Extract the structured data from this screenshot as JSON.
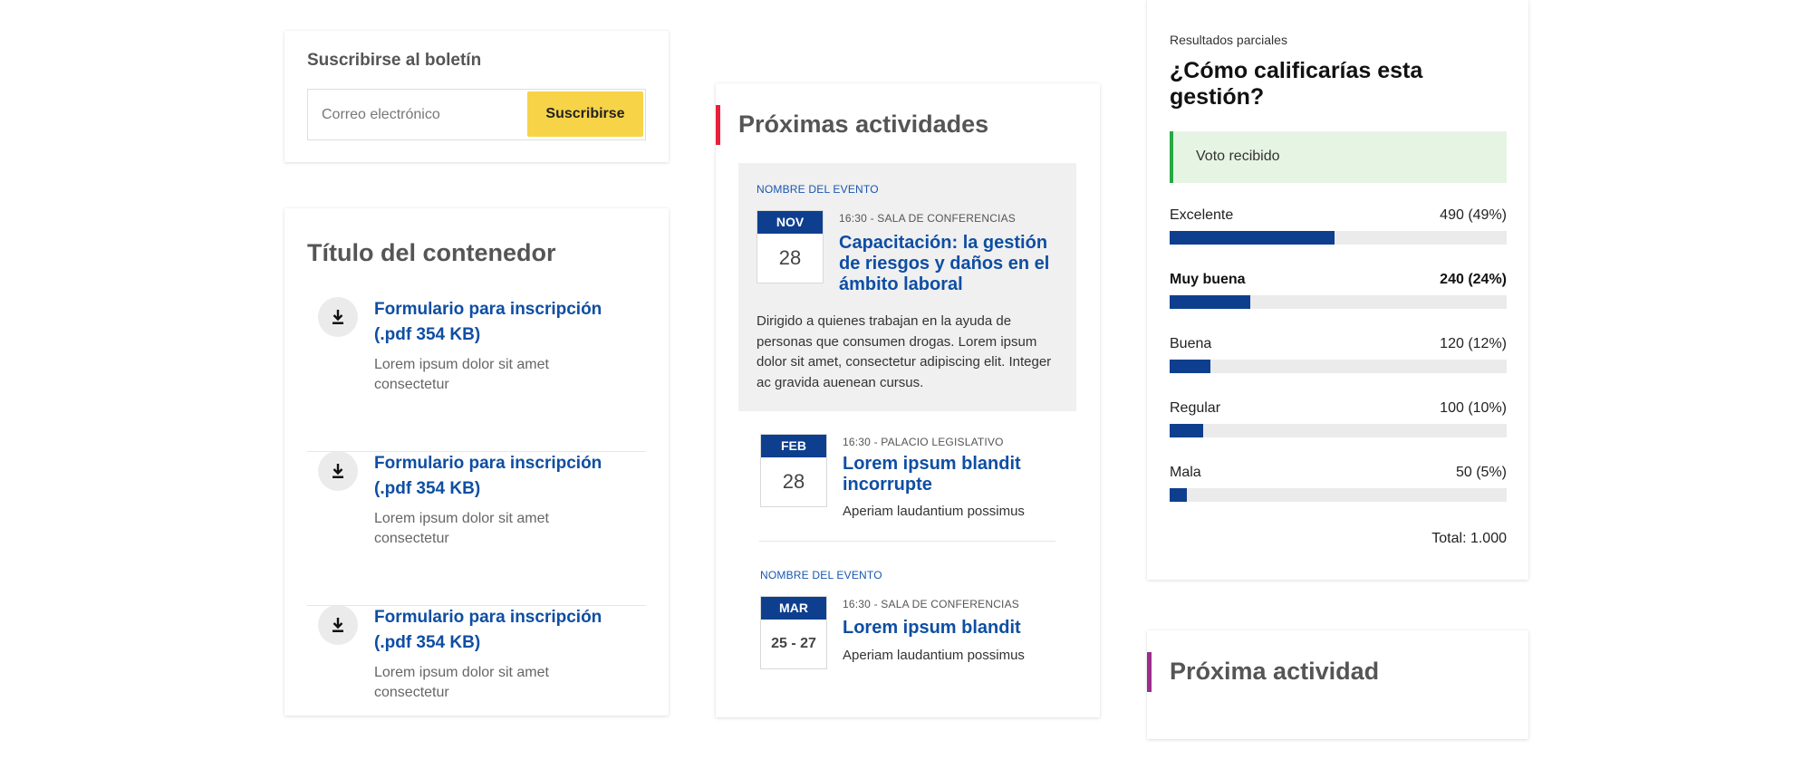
{
  "newsletter": {
    "title": "Suscribirse al boletín",
    "email_placeholder": "Correo electrónico",
    "submit_label": "Suscribirse"
  },
  "downloads": {
    "title": "Título del contenedor",
    "items": [
      {
        "link": "Formulario para inscripción (.pdf 354 KB)",
        "desc": "Lorem ipsum dolor sit amet consectetur",
        "icon": "download-icon"
      },
      {
        "link": "Formulario para inscripción (.pdf 354 KB)",
        "desc": "Lorem ipsum dolor sit amet consectetur",
        "icon": "download-icon"
      },
      {
        "link": "Formulario para inscripción (.pdf 354 KB)",
        "desc": "Lorem ipsum dolor sit amet consectetur",
        "icon": "download-icon"
      }
    ]
  },
  "activities": {
    "title": "Próximas actividades",
    "accent": "#e8203a",
    "events": [
      {
        "kicker": "NOMBRE DEL EVENTO",
        "month": "NOV",
        "day": "28",
        "meta": "16:30 - SALA DE CONFERENCIAS",
        "title": "Capacitación: la gestión de riesgos y daños en el ámbito laboral",
        "body": "Dirigido a quienes trabajan en la ayuda de personas que consumen drogas. Lorem ipsum dolor sit amet, consectetur adipiscing elit. Integer ac gravida auenean cursus."
      },
      {
        "month": "FEB",
        "day": "28",
        "meta": "16:30 - PALACIO LEGISLATIVO",
        "title": "Lorem ipsum blandit incorrupte",
        "sub": "Aperiam laudantium possimus"
      },
      {
        "kicker": "NOMBRE DEL EVENTO",
        "month": "MAR",
        "day": "25 - 27",
        "meta": "16:30 - SALA DE CONFERENCIAS",
        "title": "Lorem ipsum blandit",
        "sub": "Aperiam laudantium possimus"
      }
    ]
  },
  "poll": {
    "kicker": "Resultados parciales",
    "question": "¿Cómo calificarías esta gestión?",
    "alert": "Voto recibido",
    "alert_color": "#27a844",
    "bar_color": "#0e3f8f",
    "options": [
      {
        "label": "Excelente",
        "count": "490 (49%)",
        "fraction": 0.49
      },
      {
        "label": "Muy buena",
        "count": "240 (24%)",
        "fraction": 0.24
      },
      {
        "label": "Buena",
        "count": "120 (12%)",
        "fraction": 0.12
      },
      {
        "label": "Regular",
        "count": "100 (10%)",
        "fraction": 0.1
      },
      {
        "label": "Mala",
        "count": "50 (5%)",
        "fraction": 0.05
      }
    ],
    "total": "Total: 1.000"
  },
  "next_activity": {
    "title": "Próxima actividad",
    "accent": "#9b2d8e"
  }
}
